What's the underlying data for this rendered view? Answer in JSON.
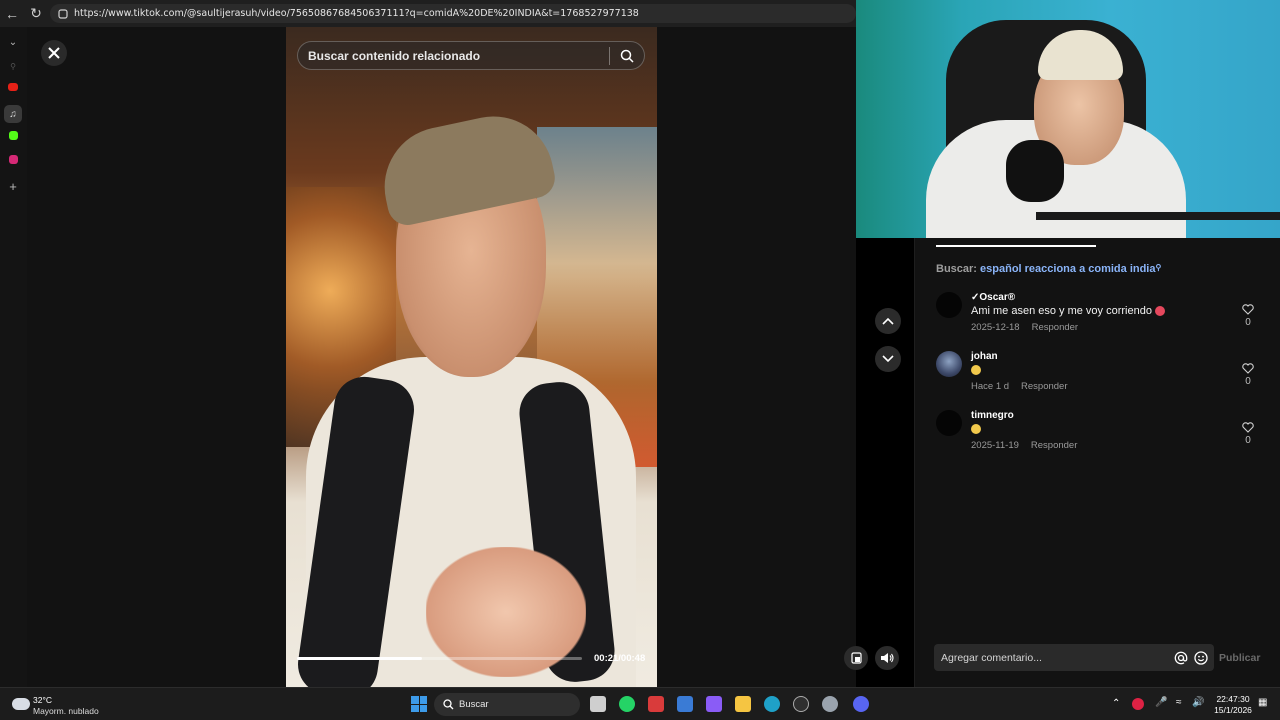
{
  "browser": {
    "url": "https://www.tiktok.com/@saultijerasuh/video/7565086768450637111?q=comidA%20DE%20INDIA&t=1768527977138"
  },
  "search": {
    "placeholder": "Buscar contenido relacionado"
  },
  "video": {
    "time": "00:21/00:48",
    "progress_fraction": 0.44
  },
  "comments_panel": {
    "buscar_label": "Buscar:",
    "buscar_query": "español reacciona a comida india",
    "reply_label": "Responder",
    "comments": [
      {
        "user": "✓Oscar®",
        "text": "Ami me asen eso y me voy corriendo",
        "date": "2025-12-18",
        "likes": "0"
      },
      {
        "user": "johan",
        "text": "",
        "date": "Hace 1 d",
        "likes": "0"
      },
      {
        "user": "timnegro",
        "text": "",
        "date": "2025-11-19",
        "likes": "0"
      }
    ],
    "comment_placeholder": "Agregar comentario...",
    "publish_label": "Publicar"
  },
  "taskbar": {
    "temperature": "32°C",
    "condition": "Mayorm. nublado",
    "search_label": "Buscar",
    "time": "22:47:30",
    "date": "15/1/2026"
  },
  "colors": {
    "link": "#8ab4f8",
    "panel_bg": "#121212",
    "accent_windows": "#3d9be9"
  }
}
